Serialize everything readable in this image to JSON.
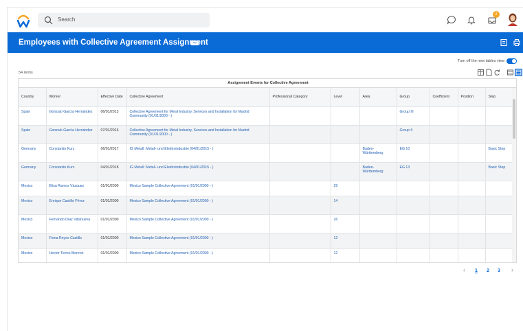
{
  "app": {
    "brand": "Workday",
    "accent": "#0a6ad6",
    "logo_colors": [
      "#f5a623",
      "#0a6ad6"
    ]
  },
  "topbar": {
    "search_placeholder": "Search",
    "icons": [
      "chat-icon",
      "bell-icon",
      "inbox-icon",
      "avatar"
    ],
    "inbox_badge": "2"
  },
  "header": {
    "title": "Employees with Collective Agreement Assignment",
    "icons": [
      "related-actions-icon",
      "export-icon",
      "print-icon"
    ]
  },
  "view_toggle": {
    "label": "Turn off the new tables view",
    "on": true
  },
  "table": {
    "count": "54 items",
    "group_title": "Assignment Events for Collective Agreement",
    "columns": [
      "Country",
      "Worker",
      "Effective Date",
      "Collective Agreement",
      "Professional Category",
      "Level",
      "Area",
      "Group",
      "Coefficient",
      "Position",
      "Step"
    ],
    "rows": [
      [
        "Spain",
        "Gonzalo García Hernández",
        "06/01/2013",
        "Collective Agreement for Metal Industry, Services and Installation for Madrid Community (01/01/2000 - )",
        "",
        "",
        "",
        "Group III",
        "",
        "",
        ""
      ],
      [
        "Spain",
        "Gonzalo García Hernández",
        "07/01/2016",
        "Collective Agreement for Metal Industry, Services and Installation for Madrid Community (01/01/2000 - )",
        "",
        "",
        "",
        "Group II",
        "",
        "",
        ""
      ],
      [
        "Germany",
        "Constantin Kurz",
        "06/01/2017",
        "IG Metall: Metall- und Elektroindustrie (04/01/2015 - )",
        "",
        "",
        "Baden-Württemberg",
        "EG 10",
        "",
        "",
        "Basic Step"
      ],
      [
        "Germany",
        "Constantin Kurz",
        "04/01/2018",
        "IG Metall: Metall- und Elektroindustrie (04/01/2015 - )",
        "",
        "",
        "Baden-Württemberg",
        "EG 13",
        "",
        "",
        "Basic Step"
      ],
      [
        "Mexico",
        "Elisa Ramos Vázquez",
        "01/01/2000",
        "Mexico Sample Collective Agreement (01/01/2000 - )",
        "",
        "29",
        "",
        "",
        "",
        "",
        ""
      ],
      [
        "Mexico",
        "Enrique Castillo Pérez",
        "01/01/2000",
        "Mexico Sample Collective Agreement (01/01/2000 - )",
        "",
        "14",
        "",
        "",
        "",
        "",
        ""
      ],
      [
        "Mexico",
        "Fernando Díaz Villanueva",
        "01/01/2000",
        "Mexico Sample Collective Agreement (01/01/2000 - )",
        "",
        "16",
        "",
        "",
        "",
        "",
        ""
      ],
      [
        "Mexico",
        "Fiona Reyes Castillo",
        "01/01/2000",
        "Mexico Sample Collective Agreement (01/01/2000 - )",
        "",
        "12",
        "",
        "",
        "",
        "",
        ""
      ],
      [
        "Mexico",
        "Hector Torres Moreno",
        "01/01/2000",
        "Mexico Sample Collective Agreement (01/01/2000 - )",
        "",
        "12",
        "",
        "",
        "",
        "",
        ""
      ]
    ]
  },
  "pagination": {
    "pages": [
      "1",
      "2",
      "3"
    ],
    "current": "1"
  }
}
